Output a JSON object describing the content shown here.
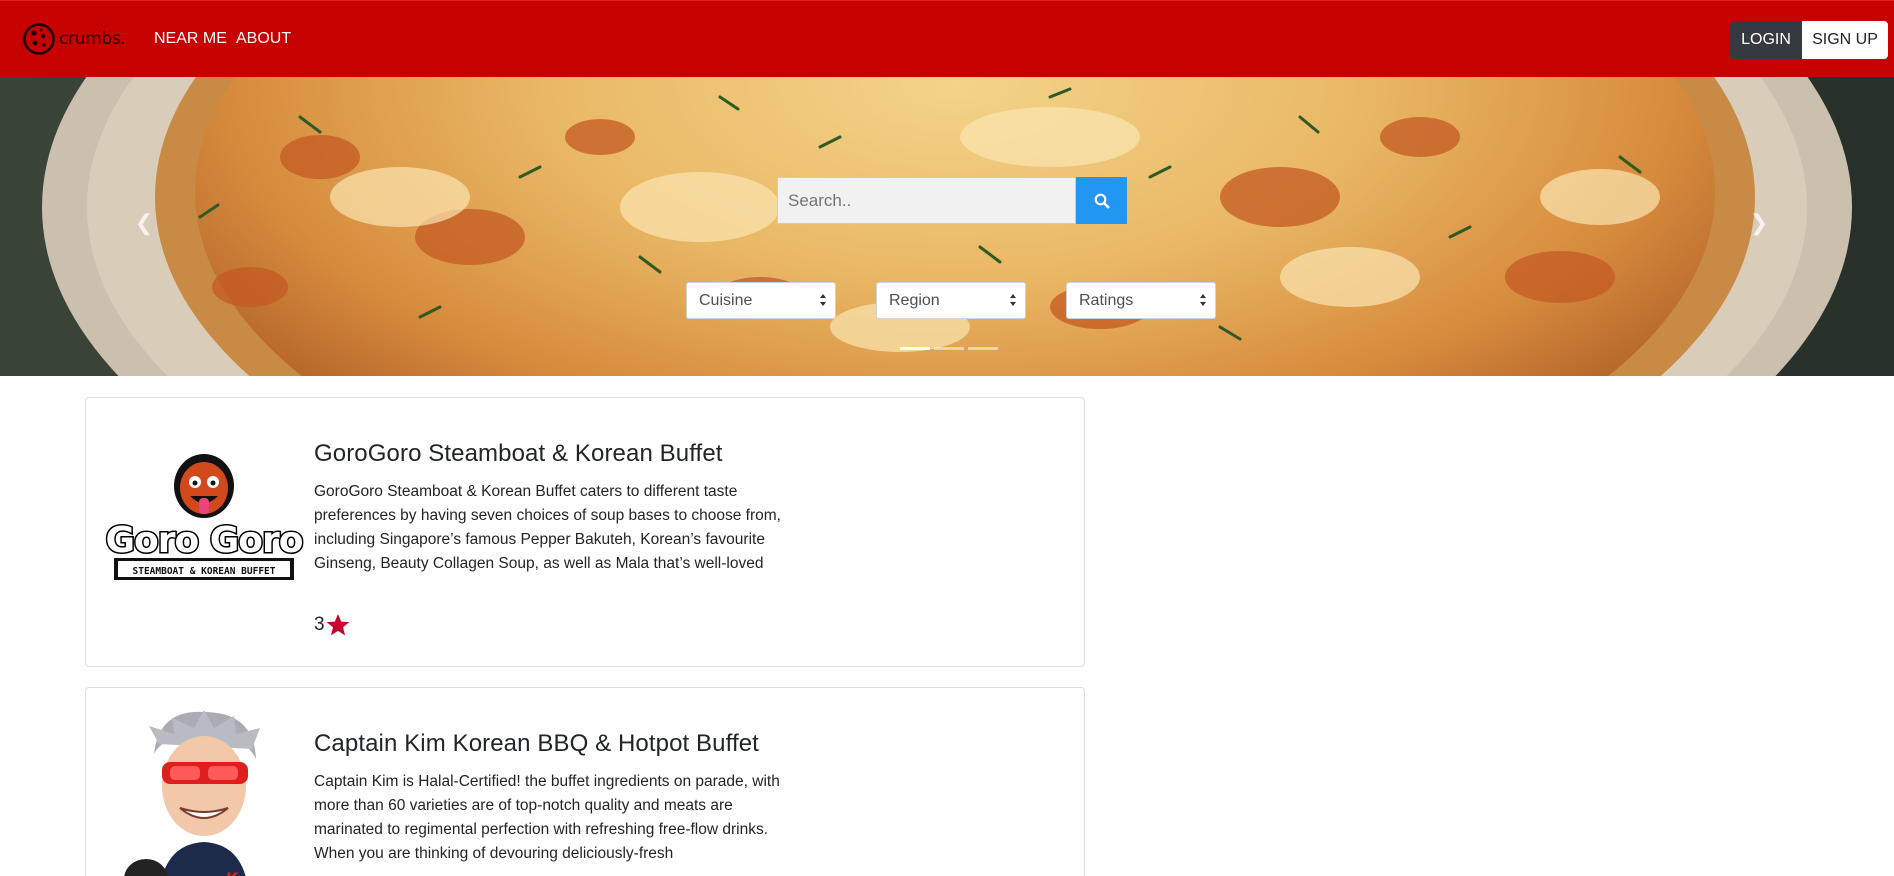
{
  "nav": {
    "brand": "crumbs.",
    "links": [
      "NEAR ME",
      "ABOUT"
    ],
    "login_label": "LOGIN",
    "signup_label": "SIGN UP",
    "bar_color": "#c70000"
  },
  "hero": {
    "search_placeholder": "Search..",
    "filters": {
      "cuisine": "Cuisine",
      "region": "Region",
      "ratings": "Ratings"
    },
    "slides": 3,
    "active_slide": 0,
    "prev_icon": "chevron-left-icon",
    "next_icon": "chevron-right-icon"
  },
  "restaurants": [
    {
      "name": "GoroGoro Steamboat & Korean Buffet",
      "description": "GoroGoro Steamboat & Korean Buffet caters to different taste preferences by having seven choices of soup bases to choose from, including Singapore’s famous Pepper Bakuteh, Korean’s favourite Ginseng, Beauty Collagen Soup, as well as Mala that’s well-loved",
      "rating": "3",
      "logo_text_top": "Goro Goro",
      "logo_text_bottom": "STEAMBOAT & KOREAN BUFFET"
    },
    {
      "name": "Captain Kim Korean BBQ & Hotpot Buffet",
      "description": "Captain Kim is Halal-Certified! the buffet ingredients on parade, with more than 60 varieties are of top-notch quality and meats are marinated to regimental perfection with refreshing free-flow drinks. When you are thinking of devouring deliciously-fresh"
    }
  ],
  "colors": {
    "search_button": "#2196f3",
    "star": "#c8002e",
    "login_bg": "#343a40"
  }
}
